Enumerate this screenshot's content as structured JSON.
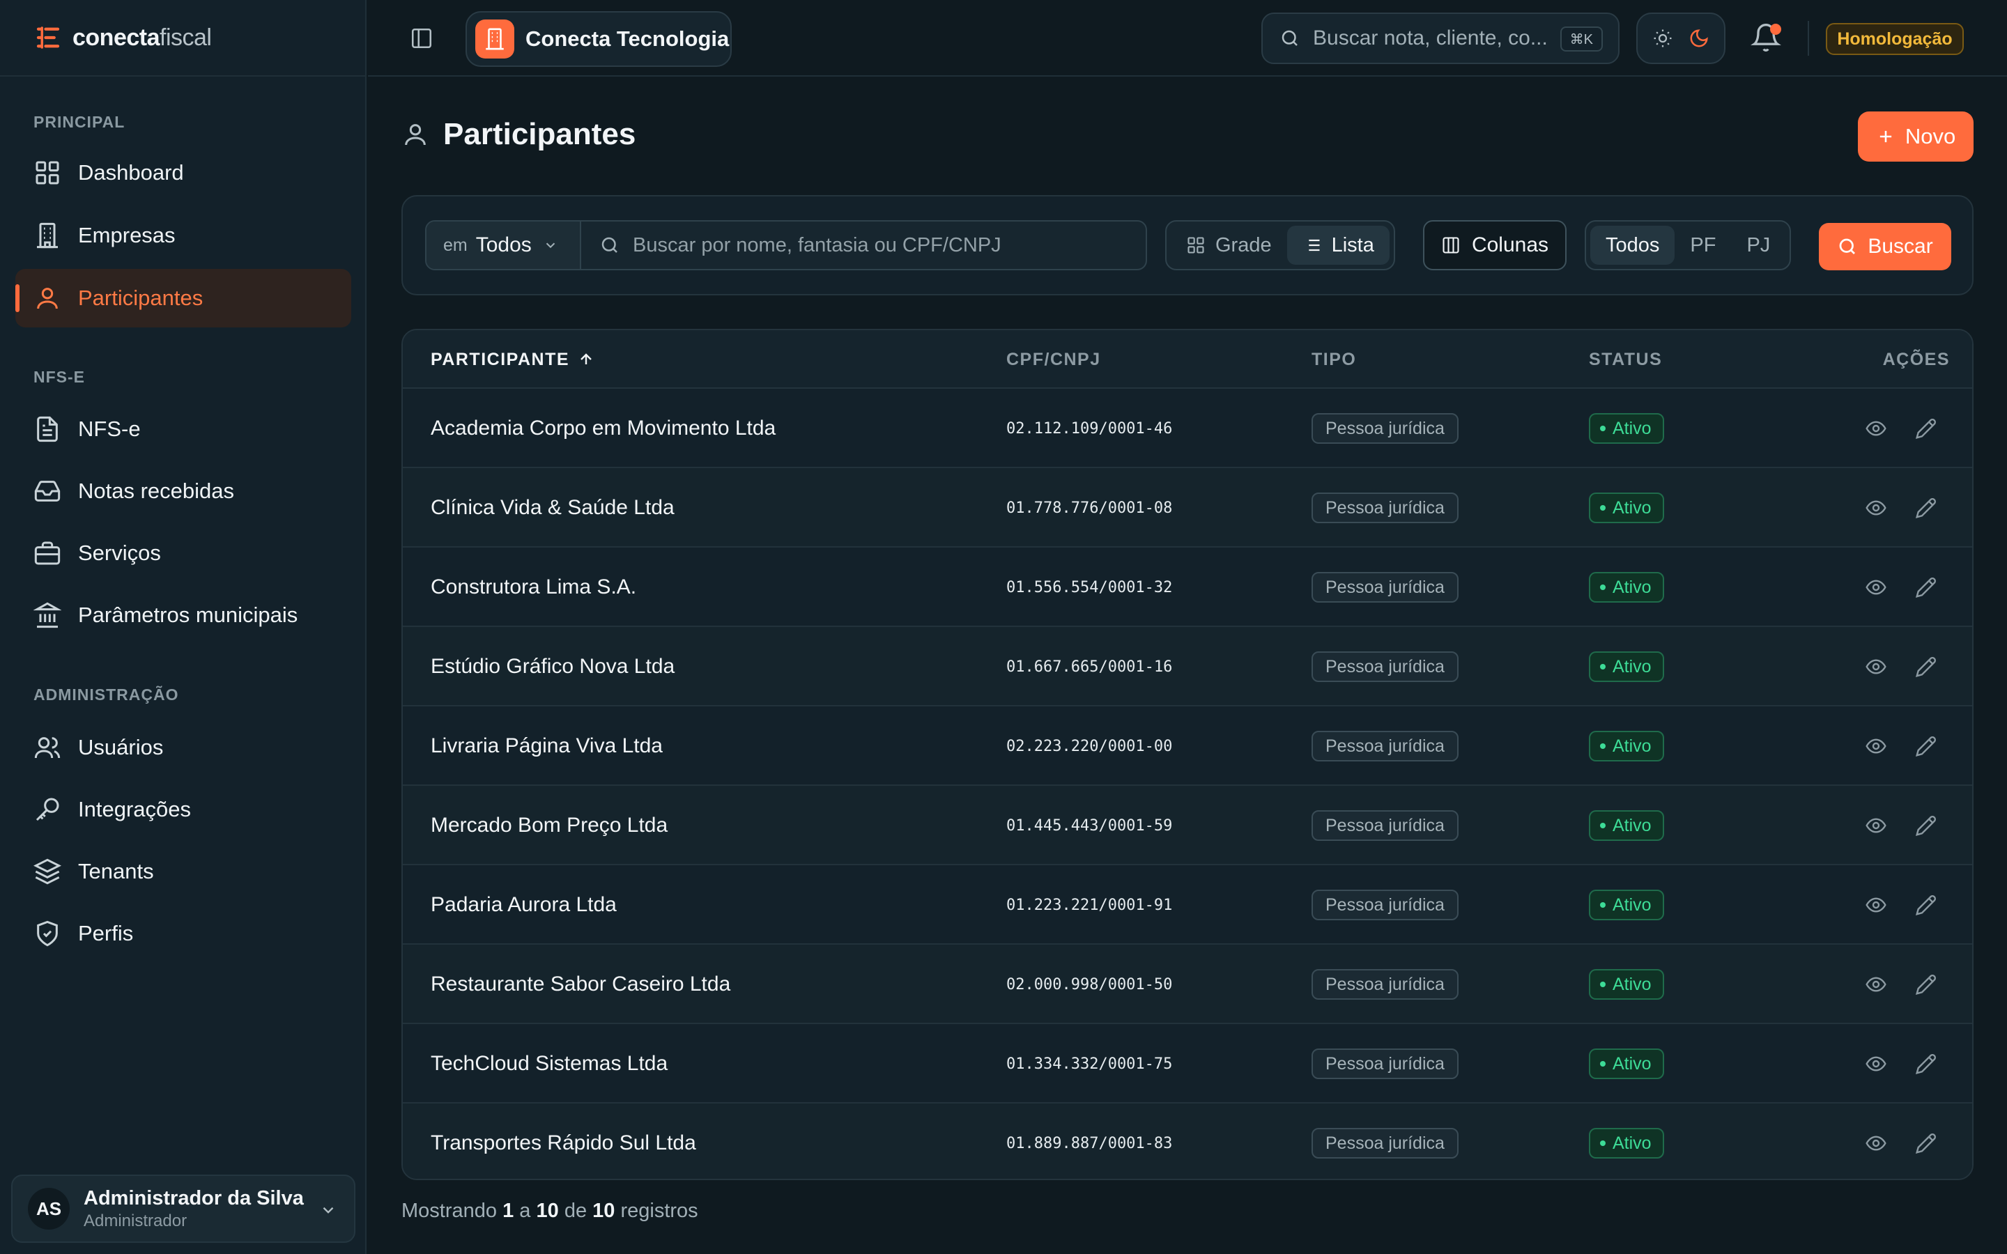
{
  "brand": {
    "name_bold": "conecta",
    "name_light": "fiscal"
  },
  "sidebar": {
    "sections": [
      {
        "title": "PRINCIPAL",
        "items": [
          {
            "label": "Dashboard",
            "icon": "dashboard-icon"
          },
          {
            "label": "Empresas",
            "icon": "building-icon"
          },
          {
            "label": "Participantes",
            "icon": "user-icon",
            "active": true
          }
        ]
      },
      {
        "title": "NFS-E",
        "items": [
          {
            "label": "NFS-e",
            "icon": "document-icon"
          },
          {
            "label": "Notas recebidas",
            "icon": "inbox-icon"
          },
          {
            "label": "Serviços",
            "icon": "briefcase-icon"
          },
          {
            "label": "Parâmetros municipais",
            "icon": "landmark-icon"
          }
        ]
      },
      {
        "title": "ADMINISTRAÇÃO",
        "items": [
          {
            "label": "Usuários",
            "icon": "users-icon"
          },
          {
            "label": "Integrações",
            "icon": "key-icon"
          },
          {
            "label": "Tenants",
            "icon": "layers-icon"
          },
          {
            "label": "Perfis",
            "icon": "shield-icon"
          }
        ]
      }
    ],
    "user": {
      "initials": "AS",
      "name": "Administrador da Silva",
      "role": "Administrador"
    }
  },
  "header": {
    "tenant": "Conecta Tecnologia",
    "search_placeholder": "Buscar nota, cliente, co...",
    "shortcut": "⌘K",
    "environment": "Homologação",
    "has_notification": true
  },
  "page": {
    "title": "Participantes",
    "new_button": "Novo"
  },
  "filters": {
    "scope_prefix": "em",
    "scope_value": "Todos",
    "search_placeholder": "Buscar por nome, fantasia ou CPF/CNPJ",
    "view_options": [
      "Grade",
      "Lista"
    ],
    "view_selected": "Lista",
    "columns_button": "Colunas",
    "type_options": [
      "Todos",
      "PF",
      "PJ"
    ],
    "type_selected": "Todos",
    "search_button": "Buscar"
  },
  "table": {
    "columns": [
      "PARTICIPANTE",
      "CPF/CNPJ",
      "TIPO",
      "STATUS",
      "AÇÕES"
    ],
    "sort_column": "PARTICIPANTE",
    "sort_direction": "asc",
    "rows": [
      {
        "name": "Academia Corpo em Movimento Ltda",
        "doc": "02.112.109/0001-46",
        "tipo": "Pessoa jurídica",
        "status": "Ativo"
      },
      {
        "name": "Clínica Vida & Saúde Ltda",
        "doc": "01.778.776/0001-08",
        "tipo": "Pessoa jurídica",
        "status": "Ativo"
      },
      {
        "name": "Construtora Lima S.A.",
        "doc": "01.556.554/0001-32",
        "tipo": "Pessoa jurídica",
        "status": "Ativo"
      },
      {
        "name": "Estúdio Gráfico Nova Ltda",
        "doc": "01.667.665/0001-16",
        "tipo": "Pessoa jurídica",
        "status": "Ativo"
      },
      {
        "name": "Livraria Página Viva Ltda",
        "doc": "02.223.220/0001-00",
        "tipo": "Pessoa jurídica",
        "status": "Ativo"
      },
      {
        "name": "Mercado Bom Preço Ltda",
        "doc": "01.445.443/0001-59",
        "tipo": "Pessoa jurídica",
        "status": "Ativo"
      },
      {
        "name": "Padaria Aurora Ltda",
        "doc": "01.223.221/0001-91",
        "tipo": "Pessoa jurídica",
        "status": "Ativo"
      },
      {
        "name": "Restaurante Sabor Caseiro Ltda",
        "doc": "02.000.998/0001-50",
        "tipo": "Pessoa jurídica",
        "status": "Ativo"
      },
      {
        "name": "TechCloud Sistemas Ltda",
        "doc": "01.334.332/0001-75",
        "tipo": "Pessoa jurídica",
        "status": "Ativo"
      },
      {
        "name": "Transportes Rápido Sul Ltda",
        "doc": "01.889.887/0001-83",
        "tipo": "Pessoa jurídica",
        "status": "Ativo"
      }
    ]
  },
  "pagination": {
    "prefix": "Mostrando",
    "from": "1",
    "sep1": "a",
    "to": "10",
    "sep2": "de",
    "total": "10",
    "suffix": "registros"
  },
  "colors": {
    "accent": "#ff6b3d",
    "background": "#0f1a20",
    "success": "#3ddc97",
    "warning": "#f2b93b"
  }
}
